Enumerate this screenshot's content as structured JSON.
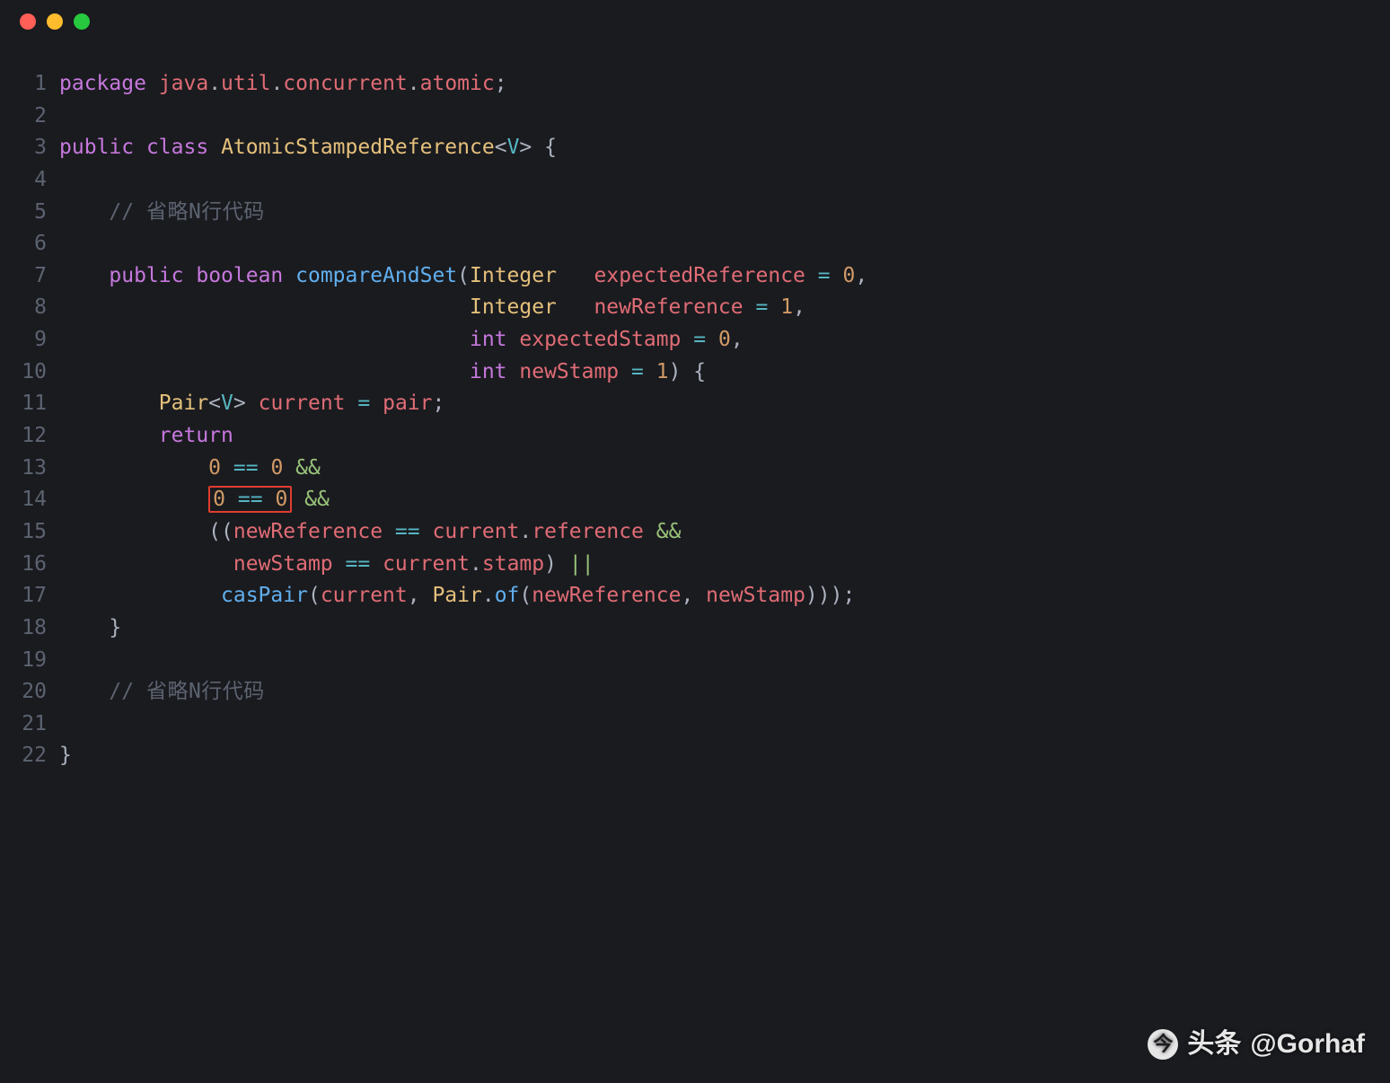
{
  "window": {
    "traffic_lights": [
      "close",
      "minimize",
      "zoom"
    ]
  },
  "code": {
    "lines": [
      {
        "n": 1,
        "tokens": [
          {
            "c": "kw",
            "t": "package"
          },
          {
            "c": "plain",
            "t": " "
          },
          {
            "c": "ident",
            "t": "java"
          },
          {
            "c": "pun",
            "t": "."
          },
          {
            "c": "ident",
            "t": "util"
          },
          {
            "c": "pun",
            "t": "."
          },
          {
            "c": "ident",
            "t": "concurrent"
          },
          {
            "c": "pun",
            "t": "."
          },
          {
            "c": "ident",
            "t": "atomic"
          },
          {
            "c": "pun",
            "t": ";"
          }
        ]
      },
      {
        "n": 2,
        "tokens": []
      },
      {
        "n": 3,
        "tokens": [
          {
            "c": "kw",
            "t": "public"
          },
          {
            "c": "plain",
            "t": " "
          },
          {
            "c": "kw",
            "t": "class"
          },
          {
            "c": "plain",
            "t": " "
          },
          {
            "c": "cls",
            "t": "AtomicStampedReference"
          },
          {
            "c": "pun",
            "t": "<"
          },
          {
            "c": "type",
            "t": "V"
          },
          {
            "c": "pun",
            "t": "> {"
          }
        ]
      },
      {
        "n": 4,
        "tokens": []
      },
      {
        "n": 5,
        "tokens": [
          {
            "c": "plain",
            "t": "    "
          },
          {
            "c": "cmt",
            "t": "// "
          },
          {
            "c": "cmtcn",
            "t": "省略N行代码"
          }
        ]
      },
      {
        "n": 6,
        "tokens": []
      },
      {
        "n": 7,
        "tokens": [
          {
            "c": "plain",
            "t": "    "
          },
          {
            "c": "kw",
            "t": "public"
          },
          {
            "c": "plain",
            "t": " "
          },
          {
            "c": "kw",
            "t": "boolean"
          },
          {
            "c": "plain",
            "t": " "
          },
          {
            "c": "fn",
            "t": "compareAndSet"
          },
          {
            "c": "pun",
            "t": "("
          },
          {
            "c": "cls",
            "t": "Integer"
          },
          {
            "c": "plain",
            "t": "   "
          },
          {
            "c": "ident",
            "t": "expectedReference"
          },
          {
            "c": "plain",
            "t": " "
          },
          {
            "c": "op",
            "t": "="
          },
          {
            "c": "plain",
            "t": " "
          },
          {
            "c": "num",
            "t": "0"
          },
          {
            "c": "pun",
            "t": ","
          }
        ]
      },
      {
        "n": 8,
        "tokens": [
          {
            "c": "plain",
            "t": "                                 "
          },
          {
            "c": "cls",
            "t": "Integer"
          },
          {
            "c": "plain",
            "t": "   "
          },
          {
            "c": "ident",
            "t": "newReference"
          },
          {
            "c": "plain",
            "t": " "
          },
          {
            "c": "op",
            "t": "="
          },
          {
            "c": "plain",
            "t": " "
          },
          {
            "c": "num",
            "t": "1"
          },
          {
            "c": "pun",
            "t": ","
          }
        ]
      },
      {
        "n": 9,
        "tokens": [
          {
            "c": "plain",
            "t": "                                 "
          },
          {
            "c": "kw",
            "t": "int"
          },
          {
            "c": "plain",
            "t": " "
          },
          {
            "c": "ident",
            "t": "expectedStamp"
          },
          {
            "c": "plain",
            "t": " "
          },
          {
            "c": "op",
            "t": "="
          },
          {
            "c": "plain",
            "t": " "
          },
          {
            "c": "num",
            "t": "0"
          },
          {
            "c": "pun",
            "t": ","
          }
        ]
      },
      {
        "n": 10,
        "tokens": [
          {
            "c": "plain",
            "t": "                                 "
          },
          {
            "c": "kw",
            "t": "int"
          },
          {
            "c": "plain",
            "t": " "
          },
          {
            "c": "ident",
            "t": "newStamp"
          },
          {
            "c": "plain",
            "t": " "
          },
          {
            "c": "op",
            "t": "="
          },
          {
            "c": "plain",
            "t": " "
          },
          {
            "c": "num",
            "t": "1"
          },
          {
            "c": "pun",
            "t": ") {"
          }
        ]
      },
      {
        "n": 11,
        "tokens": [
          {
            "c": "plain",
            "t": "        "
          },
          {
            "c": "cls",
            "t": "Pair"
          },
          {
            "c": "pun",
            "t": "<"
          },
          {
            "c": "type",
            "t": "V"
          },
          {
            "c": "pun",
            "t": "> "
          },
          {
            "c": "ident",
            "t": "current"
          },
          {
            "c": "plain",
            "t": " "
          },
          {
            "c": "op",
            "t": "="
          },
          {
            "c": "plain",
            "t": " "
          },
          {
            "c": "ident",
            "t": "pair"
          },
          {
            "c": "pun",
            "t": ";"
          }
        ]
      },
      {
        "n": 12,
        "tokens": [
          {
            "c": "plain",
            "t": "        "
          },
          {
            "c": "kw",
            "t": "return"
          }
        ]
      },
      {
        "n": 13,
        "tokens": [
          {
            "c": "plain",
            "t": "            "
          },
          {
            "c": "num",
            "t": "0"
          },
          {
            "c": "plain",
            "t": " "
          },
          {
            "c": "op",
            "t": "=="
          },
          {
            "c": "plain",
            "t": " "
          },
          {
            "c": "num",
            "t": "0"
          },
          {
            "c": "plain",
            "t": " "
          },
          {
            "c": "green",
            "t": "&&"
          }
        ]
      },
      {
        "n": 14,
        "tokens": [
          {
            "c": "plain",
            "t": "            "
          },
          {
            "c": "num",
            "t": "0",
            "box_start": true
          },
          {
            "c": "plain",
            "t": " "
          },
          {
            "c": "op",
            "t": "=="
          },
          {
            "c": "plain",
            "t": " "
          },
          {
            "c": "num",
            "t": "0",
            "box_end": true
          },
          {
            "c": "plain",
            "t": " "
          },
          {
            "c": "green",
            "t": "&&"
          }
        ]
      },
      {
        "n": 15,
        "tokens": [
          {
            "c": "plain",
            "t": "            "
          },
          {
            "c": "pun",
            "t": "(("
          },
          {
            "c": "ident",
            "t": "newReference"
          },
          {
            "c": "plain",
            "t": " "
          },
          {
            "c": "op",
            "t": "=="
          },
          {
            "c": "plain",
            "t": " "
          },
          {
            "c": "ident",
            "t": "current"
          },
          {
            "c": "pun",
            "t": "."
          },
          {
            "c": "ident",
            "t": "reference"
          },
          {
            "c": "plain",
            "t": " "
          },
          {
            "c": "green",
            "t": "&&"
          }
        ]
      },
      {
        "n": 16,
        "tokens": [
          {
            "c": "plain",
            "t": "              "
          },
          {
            "c": "ident",
            "t": "newStamp"
          },
          {
            "c": "plain",
            "t": " "
          },
          {
            "c": "op",
            "t": "=="
          },
          {
            "c": "plain",
            "t": " "
          },
          {
            "c": "ident",
            "t": "current"
          },
          {
            "c": "pun",
            "t": "."
          },
          {
            "c": "ident",
            "t": "stamp"
          },
          {
            "c": "pun",
            "t": ")"
          },
          {
            "c": "plain",
            "t": " "
          },
          {
            "c": "green",
            "t": "||"
          }
        ]
      },
      {
        "n": 17,
        "tokens": [
          {
            "c": "plain",
            "t": "             "
          },
          {
            "c": "fn",
            "t": "casPair"
          },
          {
            "c": "pun",
            "t": "("
          },
          {
            "c": "ident",
            "t": "current"
          },
          {
            "c": "pun",
            "t": ", "
          },
          {
            "c": "cls",
            "t": "Pair"
          },
          {
            "c": "pun",
            "t": "."
          },
          {
            "c": "fn",
            "t": "of"
          },
          {
            "c": "pun",
            "t": "("
          },
          {
            "c": "ident",
            "t": "newReference"
          },
          {
            "c": "pun",
            "t": ", "
          },
          {
            "c": "ident",
            "t": "newStamp"
          },
          {
            "c": "pun",
            "t": ")));"
          }
        ]
      },
      {
        "n": 18,
        "tokens": [
          {
            "c": "plain",
            "t": "    "
          },
          {
            "c": "pun",
            "t": "}"
          }
        ]
      },
      {
        "n": 19,
        "tokens": []
      },
      {
        "n": 20,
        "tokens": [
          {
            "c": "plain",
            "t": "    "
          },
          {
            "c": "cmt",
            "t": "// "
          },
          {
            "c": "cmtcn",
            "t": "省略N行代码"
          }
        ]
      },
      {
        "n": 21,
        "tokens": []
      },
      {
        "n": 22,
        "tokens": [
          {
            "c": "pun",
            "t": "}"
          }
        ]
      }
    ]
  },
  "watermark": {
    "prefix": "头条",
    "handle": "@Gorhaf"
  }
}
